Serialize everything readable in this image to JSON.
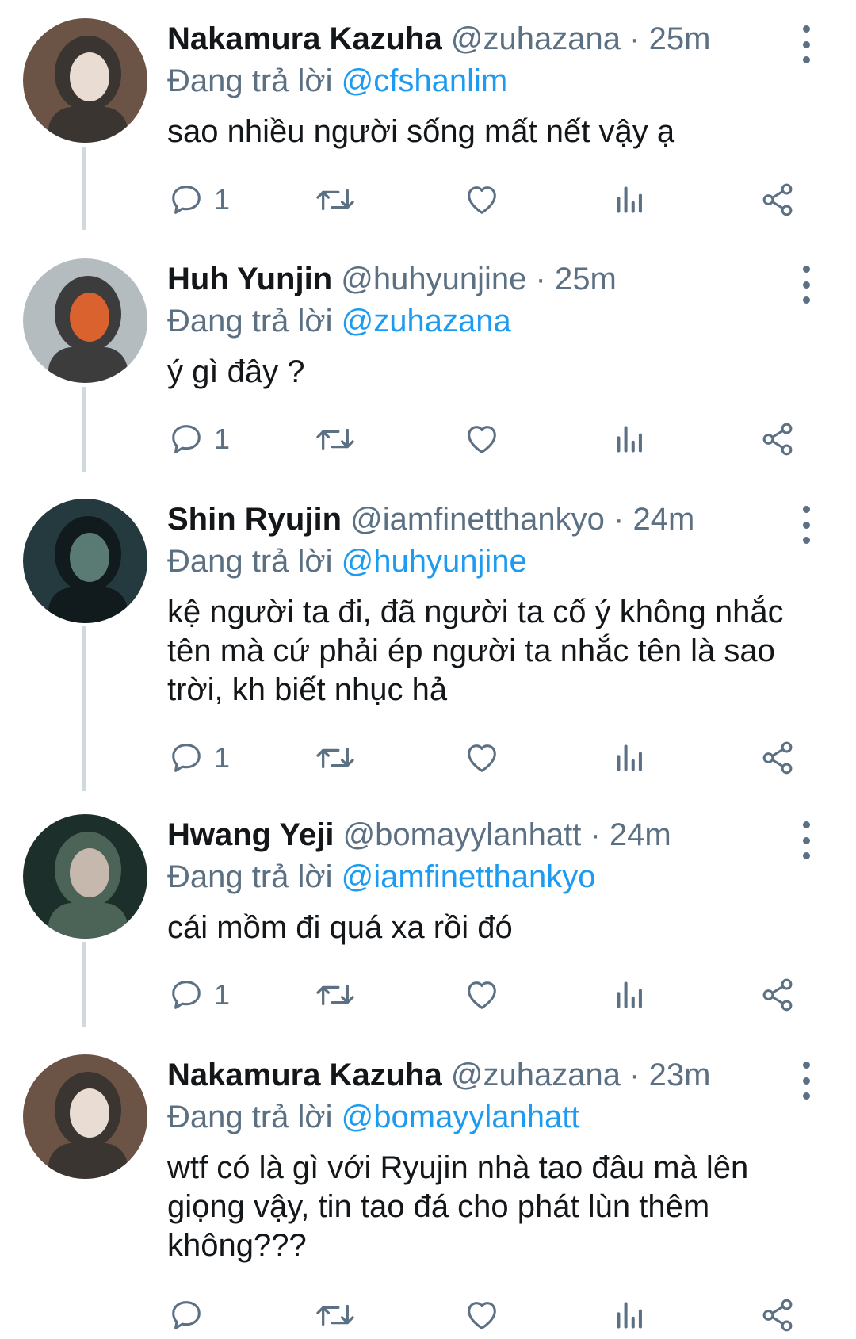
{
  "tweets": [
    {
      "name": "Nakamura Kazuha",
      "handle": "@zuhazana",
      "dot": "·",
      "time": "25m",
      "reply_prefix": "Đang trả lời",
      "reply_to": "@cfshanlim",
      "text": "sao nhiều người sống mất nết vậy ạ",
      "reply_count": "1",
      "avatar_colors": [
        "#6b5346",
        "#e9ddd3",
        "#3b3531"
      ]
    },
    {
      "name": "Huh Yunjin",
      "handle": "@huhyunjine",
      "dot": "·",
      "time": "25m",
      "reply_prefix": "Đang trả lời",
      "reply_to": "@zuhazana",
      "text": "ý gì đây ?",
      "reply_count": "1",
      "avatar_colors": [
        "#b5bcc0",
        "#d9622e",
        "#3c3c3c"
      ]
    },
    {
      "name": "Shin Ryujin",
      "handle": "@iamfinetthankyo",
      "dot": "·",
      "time": "24m",
      "reply_prefix": "Đang trả lời",
      "reply_to": "@huhyunjine",
      "text": "kệ người ta đi, đã người ta cố ý không nhắc tên mà cứ phải ép người ta nhắc tên là sao trời, kh biết nhục hả",
      "reply_count": "1",
      "avatar_colors": [
        "#243a3e",
        "#5a7b74",
        "#111b1d"
      ]
    },
    {
      "name": "Hwang Yeji",
      "handle": "@bomayylanhatt",
      "dot": "·",
      "time": "24m",
      "reply_prefix": "Đang trả lời",
      "reply_to": "@iamfinetthankyo",
      "text": "cái mồm đi quá xa rồi đó",
      "reply_count": "1",
      "avatar_colors": [
        "#1d2f2a",
        "#c7b8ae",
        "#4c6357"
      ]
    },
    {
      "name": "Nakamura Kazuha",
      "handle": "@zuhazana",
      "dot": "·",
      "time": "23m",
      "reply_prefix": "Đang trả lời",
      "reply_to": "@bomayylanhatt",
      "text": "wtf có là gì với Ryujin nhà tao đâu mà lên giọng vậy, tin tao đá cho phát lùn thêm không???",
      "reply_count": "",
      "avatar_colors": [
        "#6b5346",
        "#e9ddd3",
        "#3b3531"
      ]
    }
  ],
  "icons": [
    "reply-icon",
    "retweet-icon",
    "like-icon",
    "analytics-icon",
    "share-icon",
    "more-options-icon"
  ],
  "colors": {
    "text": "#14171a",
    "secondary": "#5b7083",
    "link": "#1d9bf0",
    "thread_line": "#cfd9de"
  }
}
